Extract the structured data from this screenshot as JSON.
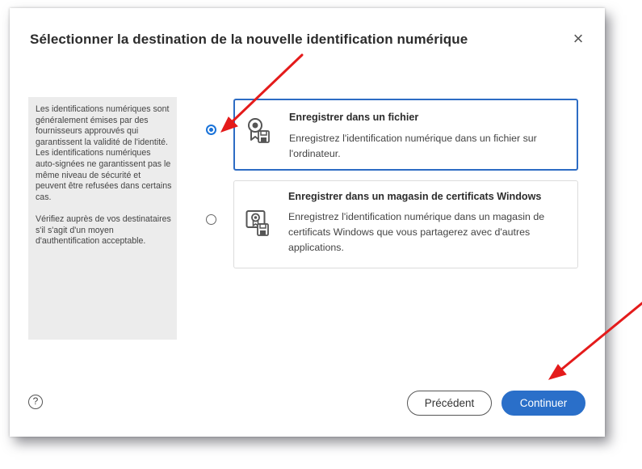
{
  "dialog": {
    "title": "Sélectionner la destination de la nouvelle identification numérique",
    "close_glyph": "×"
  },
  "info_panel": {
    "paragraph1": "Les identifications numériques sont généralement émises par des fournisseurs approuvés qui garantissent la validité de l'identité. Les identifications numériques auto-signées ne garantissent pas le même niveau de sécurité et peuvent être refusées dans certains cas.",
    "paragraph2": "Vérifiez auprès de vos destinataires s'il s'agit d'un moyen d'authentification acceptable."
  },
  "options": [
    {
      "title": "Enregistrer dans un fichier",
      "description": "Enregistrez l'identification numérique dans un fichier sur l'ordinateur.",
      "selected": true,
      "icon": "certificate-file-icon"
    },
    {
      "title": "Enregistrer dans un magasin de certificats Windows",
      "description": "Enregistrez l'identification numérique dans un magasin de certificats Windows que vous partagerez avec d'autres applications.",
      "selected": false,
      "icon": "certificate-store-icon"
    }
  ],
  "footer": {
    "help_glyph": "?",
    "previous_label": "Précédent",
    "continue_label": "Continuer"
  },
  "colors": {
    "accent": "#2a6fc9",
    "annotation_arrow": "#e41b1b"
  }
}
